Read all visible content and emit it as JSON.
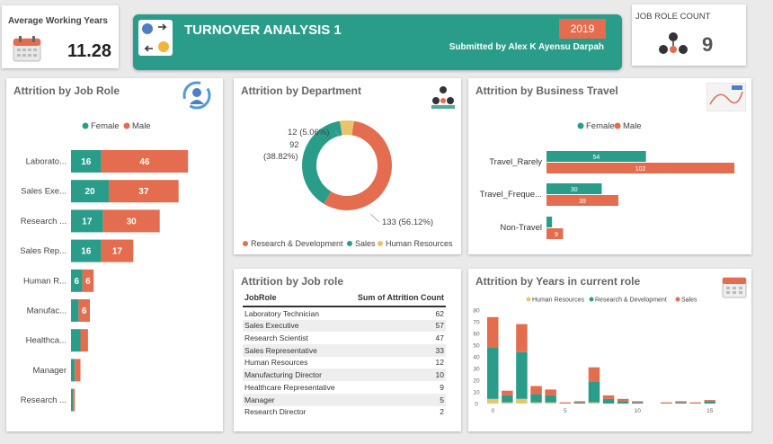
{
  "kpi_avg": {
    "title": "Average Working Years",
    "value": "11.28",
    "icon": "calendar-icon"
  },
  "header": {
    "title": "TURNOVER ANALYSIS 1",
    "year": "2019",
    "submitted": "Submitted by Alex K Ayensu Darpah",
    "icon": "people-exchange-icon"
  },
  "kpi_role": {
    "title": "JOB ROLE COUNT",
    "value": "9",
    "icon": "team-icon"
  },
  "colors": {
    "teal": "#2a9d8a",
    "orange": "#e46c4f",
    "yellow": "#e8c46a",
    "header_bg": "#2a9d8a"
  },
  "chart_data": [
    {
      "id": "job_role",
      "type": "bar",
      "title": "Attrition by Job Role",
      "orientation": "horizontal-stacked",
      "legend": [
        "Female",
        "Male"
      ],
      "legend_position": "top",
      "categories": [
        "Laborato...",
        "Sales Exe...",
        "Research ...",
        "Sales Rep...",
        "Human R...",
        "Manufac...",
        "Healthca...",
        "Manager",
        "Research ..."
      ],
      "series": [
        {
          "name": "Female",
          "values": [
            16,
            20,
            17,
            16,
            6,
            4,
            5,
            2,
            1
          ]
        },
        {
          "name": "Male",
          "values": [
            46,
            37,
            30,
            17,
            6,
            6,
            4,
            3,
            1
          ]
        }
      ],
      "data_labels": [
        [
          "16",
          "46"
        ],
        [
          "20",
          "37"
        ],
        [
          "17",
          "30"
        ],
        [
          "16",
          "17"
        ],
        [
          "6",
          "6"
        ],
        [
          "",
          "6"
        ],
        [
          "",
          ""
        ],
        [
          "",
          ""
        ],
        [
          "",
          ""
        ]
      ]
    },
    {
      "id": "department",
      "type": "pie",
      "title": "Attrition by Department",
      "donut": true,
      "slices": [
        {
          "name": "Research & Development",
          "value": 133,
          "label": "133 (56.12%)"
        },
        {
          "name": "Sales",
          "value": 92,
          "label": "92 (38.82%)"
        },
        {
          "name": "Human Resources",
          "value": 12,
          "label": "12 (5.06%)"
        }
      ],
      "legend_position": "bottom"
    },
    {
      "id": "travel",
      "type": "bar",
      "title": "Attrition by Business Travel",
      "orientation": "horizontal-grouped",
      "legend": [
        "Female",
        "Male"
      ],
      "categories": [
        "Travel_Rarely",
        "Travel_Freque...",
        "Non-Travel"
      ],
      "series": [
        {
          "name": "Female",
          "values": [
            54,
            30,
            3
          ]
        },
        {
          "name": "Male",
          "values": [
            102,
            39,
            9
          ]
        }
      ],
      "data_labels": [
        [
          "54",
          "102"
        ],
        [
          "30",
          "39"
        ],
        [
          "",
          "9"
        ]
      ]
    },
    {
      "id": "years_in_role",
      "type": "bar",
      "title": "Attrition by Years in current role",
      "orientation": "vertical-stacked",
      "legend": [
        "Human Resources",
        "Research & Development",
        "Sales"
      ],
      "legend_position": "top",
      "x": [
        0,
        1,
        2,
        3,
        4,
        5,
        6,
        7,
        8,
        9,
        10,
        11,
        12,
        13,
        14,
        15
      ],
      "x_ticks": [
        "0",
        "5",
        "10",
        "15"
      ],
      "y_ticks": [
        "0",
        "10",
        "20",
        "30",
        "40",
        "50",
        "60",
        "70",
        "80"
      ],
      "ylim": [
        0,
        80
      ],
      "series": [
        {
          "name": "Human Resources",
          "values": [
            4,
            1,
            4,
            1,
            1,
            0,
            0,
            1,
            0,
            0,
            0,
            0,
            0,
            0,
            0,
            0
          ]
        },
        {
          "name": "Research & Development",
          "values": [
            44,
            6,
            40,
            7,
            6,
            0,
            1,
            18,
            4,
            2,
            1,
            0,
            0,
            1,
            0,
            2
          ]
        },
        {
          "name": "Sales",
          "values": [
            26,
            4,
            24,
            7,
            5,
            1,
            1,
            12,
            3,
            2,
            1,
            0,
            1,
            1,
            1,
            1
          ]
        }
      ]
    }
  ],
  "role_table": {
    "title": "Attrition by Job role",
    "col1": "JobRole",
    "col2": "Sum of Attrition Count",
    "rows": [
      {
        "role": "Laboratory Technician",
        "count": "62"
      },
      {
        "role": "Sales Executive",
        "count": "57"
      },
      {
        "role": "Research Scientist",
        "count": "47"
      },
      {
        "role": "Sales Representative",
        "count": "33"
      },
      {
        "role": "Human Resources",
        "count": "12"
      },
      {
        "role": "Manufacturing Director",
        "count": "10"
      },
      {
        "role": "Healthcare Representative",
        "count": "9"
      },
      {
        "role": "Manager",
        "count": "5"
      },
      {
        "role": "Research Director",
        "count": "2"
      }
    ]
  }
}
